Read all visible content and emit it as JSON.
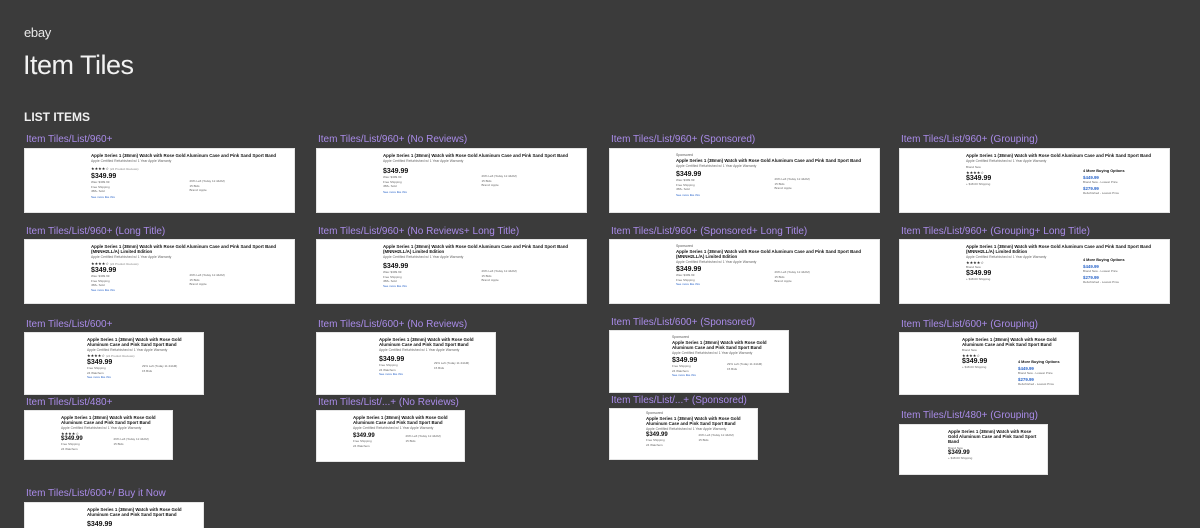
{
  "header": {
    "logo": "ebay",
    "title": "Item Tiles",
    "section": "LIST ITEMS"
  },
  "frames": [
    "Item Tiles/List/960+",
    "Item Tiles/List/960+ (No Reviews)",
    "Item Tiles/List/960+ (Sponsored)",
    "Item Tiles/List/960+ (Grouping)",
    "Item Tiles/List/960+ (Long Title)",
    "Item Tiles/List/960+ (No Reviews+ Long Title)",
    "Item Tiles/List/960+ (Sponsored+ Long Title)",
    "Item Tiles/List/960+ (Grouping+ Long Title)",
    "Item Tiles/List/600+",
    "Item Tiles/List/600+ (No Reviews)",
    "Item Tiles/List/600+ (Sponsored)",
    "Item Tiles/List/600+ (Grouping)",
    "Item Tiles/List/480+",
    "Item Tiles/List/...+ (No Reviews)",
    "Item Tiles/List/...+ (Sponsored)",
    "Item Tiles/List/480+ (Grouping)",
    "Item Tiles/List/600+/ Buy it Now"
  ],
  "item": {
    "title": "Apple Series 1 (38mm) Watch with Rose Gold Aluminum Case and Pink Sand Sport Band",
    "long_title": "Apple Series 1 (38mm) Watch with Rose Gold Aluminum Case and Pink Sand Sport Band (MNNH2LL/A) Limited Edition",
    "subtitle": "Apple Certified Refurbished w/ 1 Year Apple Warranty",
    "sponsored": "Sponsored",
    "stars": "★★★★☆",
    "reviews": "(24 Product Reviews)",
    "price": "$349.99",
    "was": "Was: $399.99",
    "shipping": "Free Shipping",
    "sold": "458+ Sold",
    "watchers": "24 Watchers",
    "deal": "29% Left (Today 11:44AM)",
    "bids": "15 Bids",
    "brand": "Brand: Apple",
    "see_more": "See more like this",
    "brand_new": "Brand New",
    "grouping_ship": "+ $18.00 Shipping",
    "more_options": "4 More Buying Options",
    "opt1_price": "$449.99",
    "opt1_label": "Brand New - Lowest Price",
    "opt2_price": "$279.99",
    "opt2_label": "Refurbished - Lowest Price"
  }
}
